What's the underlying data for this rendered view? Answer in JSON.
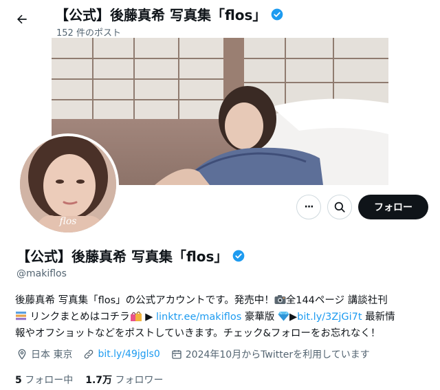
{
  "header": {
    "title": "【公式】後藤真希 写真集「flos」",
    "post_count": "152 件のポスト"
  },
  "actions": {
    "more": "···",
    "follow": "フォロー"
  },
  "profile": {
    "name": "【公式】後藤真希 写真集「flos」",
    "handle": "@makiflos",
    "avatar_watermark": "flos",
    "bio": {
      "line1": "後藤真希 写真集「flos」の公式アカウントです。発売中！",
      "line1b": "全144ページ 講談社刊",
      "line2a": "リンクまとめはコチラ",
      "line2b": "▶",
      "link1": "linktr.ee/makiflos",
      "line2c": "豪華版",
      "line2d": "▶",
      "link2": "bit.ly/3ZjGi7t",
      "line2e": "最新情",
      "line3": "報やオフショットなどをポストしていきます。チェック&フォローをお忘れなく！"
    },
    "location": "日本 東京",
    "website": "bit.ly/49jgls0",
    "joined": "2024年10月からTwitterを利用しています",
    "following_count": "5",
    "following_label": "フォロー中",
    "followers_count": "1.7万",
    "followers_label": "フォロワー"
  },
  "colors": {
    "accent": "#1d9bf0",
    "text": "#0f1419",
    "secondary": "#536471",
    "verified": "#1d9bf0"
  },
  "icons": [
    "back-arrow-icon",
    "verified-badge-icon",
    "more-icon",
    "search-icon",
    "location-icon",
    "link-icon",
    "calendar-icon",
    "camera-emoji-icon",
    "books-emoji-icon",
    "shopping-bags-emoji-icon",
    "gem-emoji-icon"
  ]
}
